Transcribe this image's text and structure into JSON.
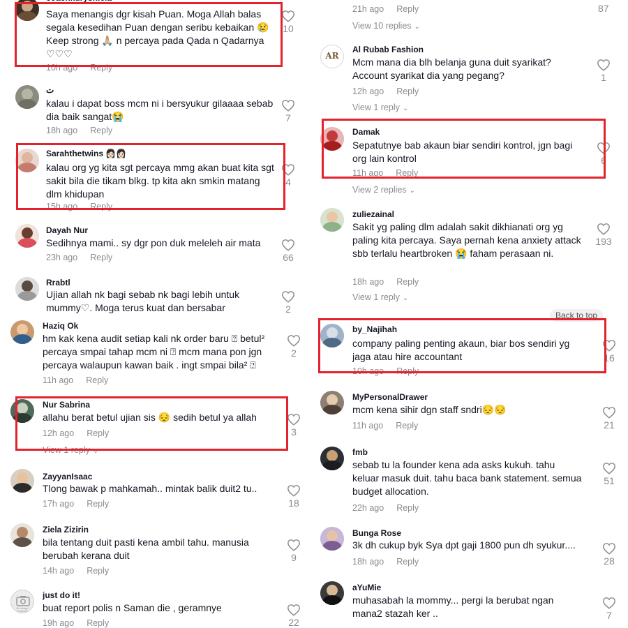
{
  "left": [
    {
      "user": "coachkuryshiela",
      "text": "Saya menangis dgr kisah Puan. Moga Allah balas segala kesedihan Puan dengan seribu kebaikan 😢 Keep strong 🙏🏼 n percaya pada Qada n Qadarnya ♡♡♡",
      "time": "10h ago",
      "reply": "Reply",
      "likes": "10"
    },
    {
      "user": "ت",
      "text": "kalau i dapat boss mcm ni i bersyukur gilaaaa sebab dia baik sangat😭",
      "time": "18h ago",
      "reply": "Reply",
      "likes": "7"
    },
    {
      "user": "Sarahthetwins 👩🏻👩🏻",
      "text": "kalau org yg kita sgt percaya mmg akan buat kita sgt sakit bila die tikam blkg. tp kita akn smkin matang dlm khidupan",
      "time": "15h ago",
      "reply": "Reply",
      "likes": "4"
    },
    {
      "user": "Dayah Nur",
      "text": "Sedihnya mami.. sy dgr pon duk meleleh air mata",
      "time": "23h ago",
      "reply": "Reply",
      "likes": "66"
    },
    {
      "user": "Rrabtl",
      "text": "Ujian allah nk bagi sebab nk bagi lebih untuk mummy♡. Moga terus kuat dan bersabar",
      "time": "",
      "reply": "",
      "likes": "2"
    },
    {
      "user": "Haziq Ok",
      "text": "hm kak kena audit setiap kali nk order baru ⍰ betul² percaya smpai tahap mcm ni ⍰ mcm mana pon jgn percaya walaupun kawan baik . ingt smpai bila² ⍰",
      "time": "11h ago",
      "reply": "Reply",
      "likes": "2"
    },
    {
      "user": "Nur Sabrina",
      "text": "allahu berat betul ujian sis 😔 sedih betul ya allah",
      "time": "12h ago",
      "reply": "Reply",
      "likes": "3",
      "view": "View 1 reply"
    },
    {
      "user": "ZayyanIsaac",
      "text": "Tlong bawak p mahkamah.. mintak balik duit2 tu..",
      "time": "17h ago",
      "reply": "Reply",
      "likes": "18"
    },
    {
      "user": "Ziela Zizirin",
      "text": "bila tentang duit pasti kena ambil tahu. manusia berubah kerana duit",
      "time": "14h ago",
      "reply": "Reply",
      "likes": "9"
    },
    {
      "user": "just do it!",
      "text": "buat report polis n Saman die , geramnye",
      "time": "19h ago",
      "reply": "Reply",
      "likes": "22",
      "avatar_label": "No image available"
    }
  ],
  "right": [
    {
      "time": "21h ago",
      "reply": "Reply",
      "likes": "87",
      "view": "View 10 replies"
    },
    {
      "user": "Al Rubab Fashion",
      "text": "Mcm mana dia blh belanja guna duit syarikat? Account syarikat dia yang pegang?",
      "time": "12h ago",
      "reply": "Reply",
      "likes": "1",
      "view": "View 1 reply",
      "avatar_label": "AR"
    },
    {
      "user": "Damak",
      "text": "Sepatutnye bab akaun biar sendiri kontrol, jgn bagi org lain kontrol",
      "time": "11h ago",
      "reply": "Reply",
      "likes": "6",
      "view": "View 2 replies"
    },
    {
      "user": "zuliezainal",
      "text": "Sakit yg paling dlm adalah sakit dikhianati org yg paling kita percaya. Saya pernah kena anxiety attack sbb terlalu heartbroken 😭 faham perasaan ni.",
      "time": "18h ago",
      "reply": "Reply",
      "likes": "193",
      "view": "View 1 reply"
    },
    {
      "user": "by_Najihah",
      "text": "company paling penting akaun, biar bos sendiri yg jaga atau hire accountant",
      "time": "10h ago",
      "reply": "Reply",
      "likes": "16"
    },
    {
      "user": "MyPersonalDrawer",
      "text": "mcm kena sihir dgn staff sndri😔😔",
      "time": "11h ago",
      "reply": "Reply",
      "likes": "21"
    },
    {
      "user": "fmb",
      "text": "sebab tu la founder kena ada asks kukuh. tahu keluar masuk duit. tahu baca bank statement. semua budget allocation.",
      "time": "22h ago",
      "reply": "Reply",
      "likes": "51"
    },
    {
      "user": "Bunga Rose",
      "text": "3k dh cukup byk Sya dpt gaji 1800 pun dh syukur....",
      "time": "18h ago",
      "reply": "Reply",
      "likes": "28"
    },
    {
      "user": "aYuMie",
      "text": "muhasabah la mommy... pergi la berubat ngan mana2 stazah ker ..",
      "time": "",
      "reply": "",
      "likes": "7"
    }
  ],
  "back_to_top": "Back to top",
  "colors": {
    "highlight": "#e3222b",
    "muted": "#8a8b91",
    "text": "#161823"
  }
}
